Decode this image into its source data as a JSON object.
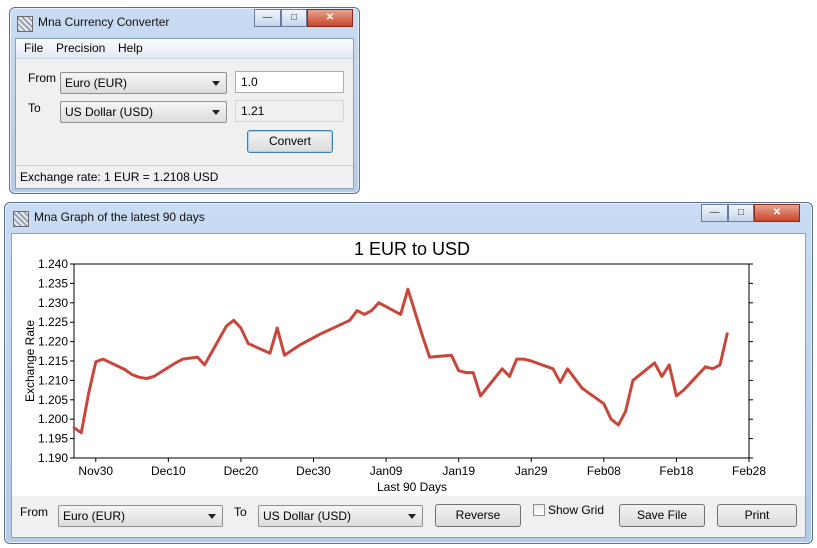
{
  "converter": {
    "title": "Mna Currency Converter",
    "menu": [
      "File",
      "Precision",
      "Help"
    ],
    "from_label": "From",
    "to_label": "To",
    "from_currency": "Euro (EUR)",
    "to_currency": "US Dollar (USD)",
    "amount": "1.0",
    "result": "1.21",
    "convert_label": "Convert",
    "status": "Exchange rate: 1 EUR = 1.2108 USD"
  },
  "graph_window": {
    "title": "Mna Graph of the latest 90 days",
    "from_label": "From",
    "to_label": "To",
    "from_currency": "Euro (EUR)",
    "to_currency": "US Dollar (USD)",
    "reverse_label": "Reverse",
    "show_grid_label": "Show Grid",
    "save_label": "Save File",
    "print_label": "Print"
  },
  "window_controls": {
    "minimize": "—",
    "maximize": "□",
    "close": "✕"
  },
  "colors": {
    "line": "#c8473a",
    "titlebar": "#c9dcf3"
  },
  "chart_data": {
    "type": "line",
    "title": "1 EUR to USD",
    "xlabel": "Last 90 Days",
    "ylabel": "Exchange Rate",
    "ylim": [
      1.19,
      1.24
    ],
    "yticks": [
      "1.190",
      "1.195",
      "1.200",
      "1.205",
      "1.210",
      "1.215",
      "1.220",
      "1.225",
      "1.230",
      "1.235",
      "1.240"
    ],
    "xlim": [
      "2020-11-27",
      "2021-02-28"
    ],
    "xticks": [
      {
        "date": "2020-11-30",
        "label": "Nov30"
      },
      {
        "date": "2020-12-10",
        "label": "Dec10"
      },
      {
        "date": "2020-12-20",
        "label": "Dec20"
      },
      {
        "date": "2020-12-30",
        "label": "Dec30"
      },
      {
        "date": "2021-01-09",
        "label": "Jan09"
      },
      {
        "date": "2021-01-19",
        "label": "Jan19"
      },
      {
        "date": "2021-01-29",
        "label": "Jan29"
      },
      {
        "date": "2021-02-08",
        "label": "Feb08"
      },
      {
        "date": "2021-02-18",
        "label": "Feb18"
      },
      {
        "date": "2021-02-28",
        "label": "Feb28"
      }
    ],
    "grid": false,
    "series": [
      {
        "color": "#c8473a",
        "x": [
          "2020-11-27",
          "2020-11-28",
          "2020-11-29",
          "2020-11-30",
          "2020-12-01",
          "2020-12-04",
          "2020-12-05",
          "2020-12-06",
          "2020-12-07",
          "2020-12-08",
          "2020-12-11",
          "2020-12-12",
          "2020-12-14",
          "2020-12-15",
          "2020-12-18",
          "2020-12-19",
          "2020-12-20",
          "2020-12-21",
          "2020-12-24",
          "2020-12-25",
          "2020-12-26",
          "2020-12-28",
          "2020-12-29",
          "2020-12-31",
          "2021-01-04",
          "2021-01-05",
          "2021-01-06",
          "2021-01-07",
          "2021-01-08",
          "2021-01-11",
          "2021-01-12",
          "2021-01-13",
          "2021-01-14",
          "2021-01-15",
          "2021-01-18",
          "2021-01-19",
          "2021-01-20",
          "2021-01-21",
          "2021-01-22",
          "2021-01-25",
          "2021-01-26",
          "2021-01-27",
          "2021-01-28",
          "2021-01-29",
          "2021-02-01",
          "2021-02-02",
          "2021-02-03",
          "2021-02-04",
          "2021-02-05",
          "2021-02-08",
          "2021-02-09",
          "2021-02-10",
          "2021-02-11",
          "2021-02-12",
          "2021-02-15",
          "2021-02-16",
          "2021-02-17",
          "2021-02-18",
          "2021-02-19",
          "2021-02-22",
          "2021-02-23",
          "2021-02-24",
          "2021-02-25"
        ],
        "y": [
          1.1978,
          1.1965,
          1.2065,
          1.2148,
          1.2155,
          1.2128,
          1.2115,
          1.2108,
          1.2105,
          1.211,
          1.2145,
          1.2155,
          1.216,
          1.214,
          1.224,
          1.2255,
          1.2235,
          1.2195,
          1.217,
          1.2235,
          1.2165,
          1.219,
          1.22,
          1.222,
          1.2255,
          1.228,
          1.227,
          1.228,
          1.23,
          1.227,
          1.2335,
          1.2275,
          1.2215,
          1.216,
          1.2165,
          1.2125,
          1.212,
          1.212,
          1.206,
          1.213,
          1.211,
          1.2155,
          1.2155,
          1.215,
          1.213,
          1.2095,
          1.213,
          1.2105,
          1.208,
          1.204,
          1.2,
          1.1985,
          1.202,
          1.21,
          1.2145,
          1.211,
          1.214,
          1.206,
          1.2075,
          1.2135,
          1.213,
          1.214,
          1.222
        ]
      }
    ]
  }
}
